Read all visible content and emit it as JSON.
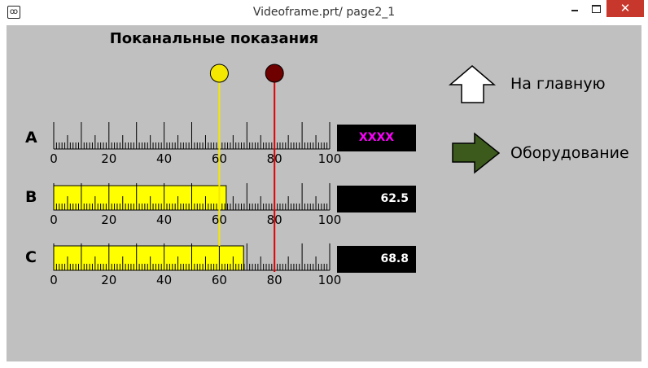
{
  "window": {
    "title": "Videoframe.prt/ page2_1",
    "app_icon": "videoframe-app-icon",
    "controls": [
      "minimize",
      "maximize",
      "close"
    ]
  },
  "heading": "Поканальные показания",
  "scale_labels": [
    "0",
    "20",
    "40",
    "60",
    "80",
    "100"
  ],
  "scale": {
    "min": 0,
    "max": 100
  },
  "markers": {
    "yellow": {
      "value": 60,
      "color": "#f5e800"
    },
    "red": {
      "value": 80,
      "color": "#e00000",
      "knob_color": "#6e0000"
    }
  },
  "channels": [
    {
      "label": "A",
      "display": "XXXX",
      "level": null
    },
    {
      "label": "B",
      "display": "62.5",
      "level": 62.5
    },
    {
      "label": "C",
      "display": "68.8",
      "level": 68.8
    }
  ],
  "nav": {
    "home_label": "На главную",
    "equipment_label": "Оборудование"
  },
  "colors": {
    "background": "#c0c0c0",
    "bar_fill": "#ffff00",
    "equipment_arrow": "#3b5a1c",
    "display_bg": "#000000",
    "display_invalid_text": "#ff00ff"
  }
}
